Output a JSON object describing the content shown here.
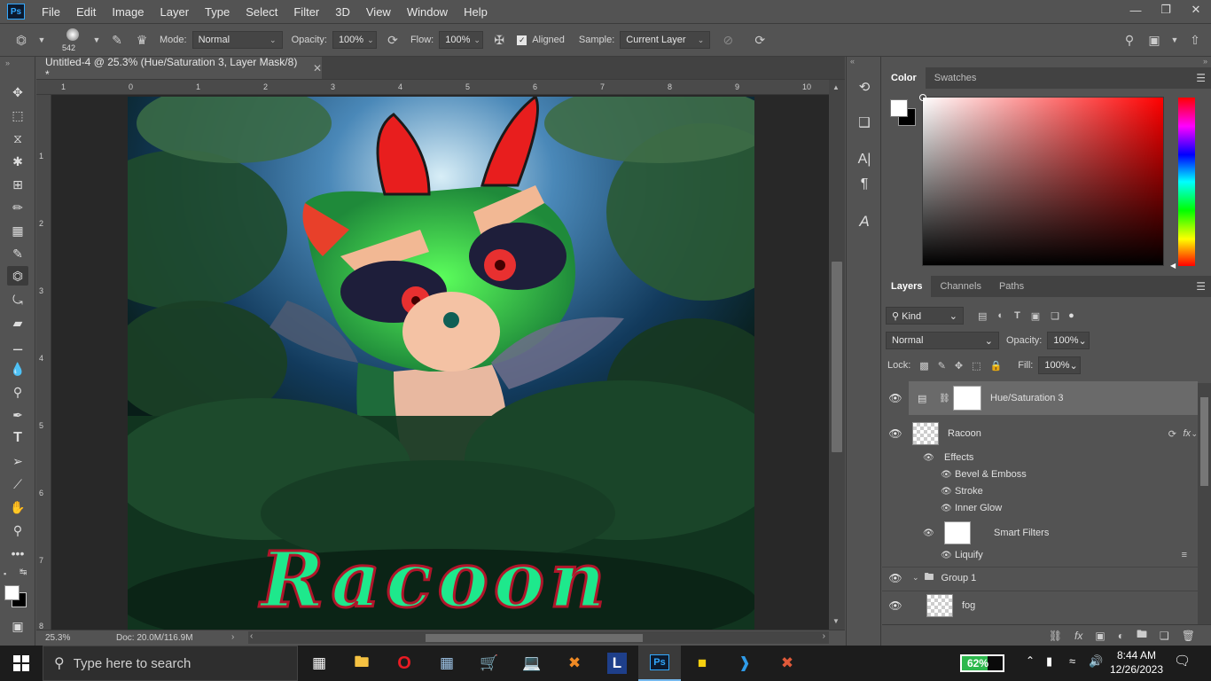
{
  "app": {
    "logo": "Ps"
  },
  "menu": [
    "File",
    "Edit",
    "Image",
    "Layer",
    "Type",
    "Select",
    "Filter",
    "3D",
    "View",
    "Window",
    "Help"
  ],
  "window_controls": [
    "minimize-icon",
    "restore-icon",
    "close-icon"
  ],
  "options": {
    "brush_size": "542",
    "mode_label": "Mode:",
    "mode_value": "Normal",
    "opacity_label": "Opacity:",
    "opacity_value": "100%",
    "flow_label": "Flow:",
    "flow_value": "100%",
    "aligned_label": "Aligned",
    "aligned_checked": true,
    "sample_label": "Sample:",
    "sample_value": "Current Layer"
  },
  "document": {
    "tab_title": "Untitled-4 @ 25.3% (Hue/Saturation 3, Layer Mask/8) *",
    "zoom": "25.3%",
    "doc_info": "Doc: 20.0M/116.9M",
    "artwork_text": "Racoon",
    "ruler_h_ticks": [
      "1",
      "0",
      "1",
      "2",
      "3",
      "4",
      "5",
      "6",
      "7",
      "8",
      "9",
      "10"
    ],
    "ruler_v_ticks": [
      "1",
      "2",
      "3",
      "4",
      "5",
      "6",
      "7",
      "8"
    ]
  },
  "color_panel": {
    "tabs": [
      "Color",
      "Swatches"
    ],
    "active_tab": "Color",
    "foreground": "#ffffff",
    "background": "#000000",
    "hue_color": "#ff0000"
  },
  "layers_panel": {
    "tabs": [
      "Layers",
      "Channels",
      "Paths"
    ],
    "active_tab": "Layers",
    "filter_kind": "Kind",
    "blend_mode": "Normal",
    "opacity_label": "Opacity:",
    "opacity_value": "100%",
    "lock_label": "Lock:",
    "fill_label": "Fill:",
    "fill_value": "100%",
    "layers": [
      {
        "name": "Hue/Saturation 3"
      },
      {
        "name": "Racoon"
      },
      {
        "name": "Effects"
      },
      {
        "name": "Bevel & Emboss"
      },
      {
        "name": "Stroke"
      },
      {
        "name": "Inner Glow"
      },
      {
        "name": "Smart Filters"
      },
      {
        "name": "Liquify"
      },
      {
        "name": "Group 1"
      },
      {
        "name": "fog"
      }
    ]
  },
  "taskbar": {
    "search_placeholder": "Type here to search",
    "battery_percent": "62%",
    "battery_level": 0.62,
    "time": "8:44 AM",
    "date": "12/26/2023"
  }
}
